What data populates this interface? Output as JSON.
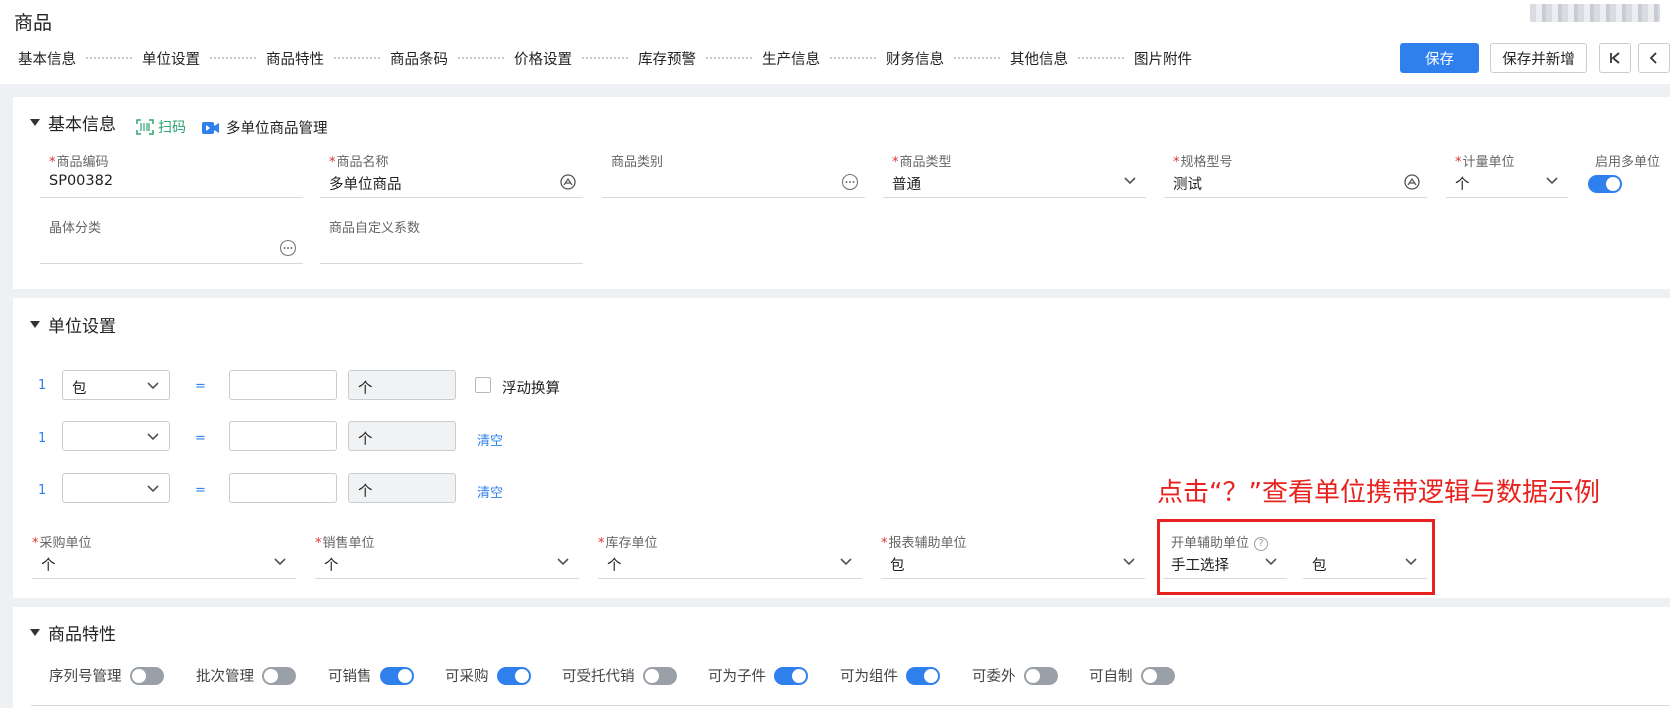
{
  "header": {
    "title": "商品",
    "nav": [
      "基本信息",
      "单位设置",
      "商品特性",
      "商品条码",
      "价格设置",
      "库存预警",
      "生产信息",
      "财务信息",
      "其他信息",
      "图片附件"
    ],
    "save_label": "保存",
    "save_new_label": "保存并新增"
  },
  "basic": {
    "title": "基本信息",
    "scan_label": "扫码",
    "multi_unit_label": "多单位商品管理",
    "fields": {
      "code": {
        "label": "商品编码",
        "value": "SP00382"
      },
      "name": {
        "label": "商品名称",
        "value": "多单位商品"
      },
      "category": {
        "label": "商品类别",
        "value": ""
      },
      "type": {
        "label": "商品类型",
        "value": "普通"
      },
      "spec": {
        "label": "规格型号",
        "value": "测试"
      },
      "unit": {
        "label": "计量单位",
        "value": "个"
      },
      "multi_unit": {
        "label": "启用多单位",
        "on": true
      },
      "crystal": {
        "label": "晶体分类",
        "value": ""
      },
      "coef": {
        "label": "商品自定义系数",
        "value": ""
      }
    }
  },
  "units": {
    "title": "单位设置",
    "rows": [
      {
        "num": "1",
        "unit": "包",
        "eq": "=",
        "qty": "",
        "base": "个",
        "extra": "浮动换算"
      },
      {
        "num": "1",
        "unit": "",
        "eq": "=",
        "qty": "",
        "base": "个",
        "extra": "清空"
      },
      {
        "num": "1",
        "unit": "",
        "eq": "=",
        "qty": "",
        "base": "个",
        "extra": "清空"
      }
    ],
    "purchase": {
      "label": "采购单位",
      "value": "个"
    },
    "sales": {
      "label": "销售单位",
      "value": "个"
    },
    "stock": {
      "label": "库存单位",
      "value": "个"
    },
    "report": {
      "label": "报表辅助单位",
      "value": "包"
    },
    "open": {
      "label": "开单辅助单位",
      "mode": "手工选择",
      "value": "包"
    },
    "annotation": "点击“？”查看单位携带逻辑与数据示例"
  },
  "features": {
    "title": "商品特性",
    "items": [
      {
        "label": "序列号管理",
        "on": false
      },
      {
        "label": "批次管理",
        "on": false
      },
      {
        "label": "可销售",
        "on": true
      },
      {
        "label": "可采购",
        "on": true
      },
      {
        "label": "可受托代销",
        "on": false
      },
      {
        "label": "可为子件",
        "on": true
      },
      {
        "label": "可为组件",
        "on": true
      },
      {
        "label": "可委外",
        "on": false
      },
      {
        "label": "可自制",
        "on": false
      }
    ]
  },
  "colors": {
    "primary": "#2f80ed",
    "required": "#e03131",
    "annotation": "#e8231f",
    "scan": "#2ba471"
  }
}
